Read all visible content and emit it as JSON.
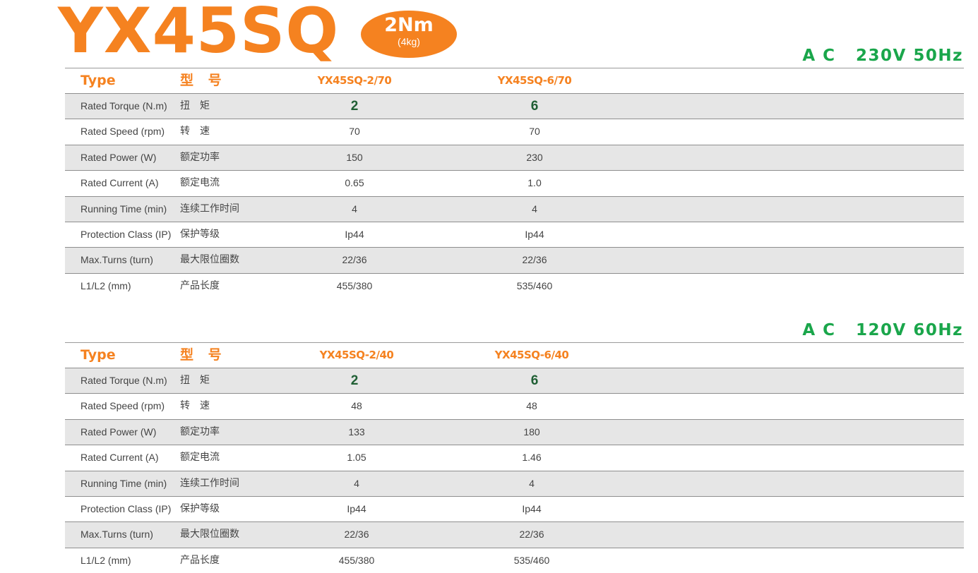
{
  "header": {
    "model": "YX45SQ",
    "torque_main": "2Nm",
    "torque_sub": "(4kg)"
  },
  "sections": [
    {
      "voltage": "A C   230V 50Hz",
      "type_en": "Type",
      "type_cn": "型 号",
      "models": [
        "YX45SQ-2/70",
        "YX45SQ-6/70"
      ],
      "rows": [
        {
          "en": "Rated Torque (N.m)",
          "cn": "扭　矩",
          "v": [
            "2",
            "6"
          ]
        },
        {
          "en": "Rated Speed (rpm)",
          "cn": "转　速",
          "v": [
            "70",
            "70"
          ]
        },
        {
          "en": "Rated Power (W)",
          "cn": "额定功率",
          "v": [
            "150",
            "230"
          ]
        },
        {
          "en": "Rated Current (A)",
          "cn": "额定电流",
          "v": [
            "0.65",
            "1.0"
          ]
        },
        {
          "en": "Running Time (min)",
          "cn": "连续工作时间",
          "v": [
            "4",
            "4"
          ]
        },
        {
          "en": "Protection Class (IP)",
          "cn": "保护等级",
          "v": [
            "Ip44",
            "Ip44"
          ]
        },
        {
          "en": "Max.Turns (turn)",
          "cn": "最大限位圈数",
          "v": [
            "22/36",
            "22/36"
          ]
        },
        {
          "en": "L1/L2 (mm)",
          "cn": "产品长度",
          "v": [
            "455/380",
            "535/460"
          ]
        }
      ]
    },
    {
      "voltage": "A C   120V 60Hz",
      "type_en": "Type",
      "type_cn": "型 号",
      "models": [
        "YX45SQ-2/40",
        "YX45SQ-6/40"
      ],
      "rows": [
        {
          "en": "Rated Torque (N.m)",
          "cn": "扭　矩",
          "v": [
            "2",
            "6"
          ]
        },
        {
          "en": "Rated Speed (rpm)",
          "cn": "转　速",
          "v": [
            "48",
            "48"
          ]
        },
        {
          "en": "Rated Power (W)",
          "cn": "额定功率",
          "v": [
            "133",
            "180"
          ]
        },
        {
          "en": "Rated Current (A)",
          "cn": "额定电流",
          "v": [
            "1.05",
            "1.46"
          ]
        },
        {
          "en": "Running Time (min)",
          "cn": "连续工作时间",
          "v": [
            "4",
            "4"
          ]
        },
        {
          "en": "Protection Class (IP)",
          "cn": "保护等级",
          "v": [
            "Ip44",
            "Ip44"
          ]
        },
        {
          "en": "Max.Turns (turn)",
          "cn": "最大限位圈数",
          "v": [
            "22/36",
            "22/36"
          ]
        },
        {
          "en": "L1/L2 (mm)",
          "cn": "产品长度",
          "v": [
            "455/380",
            "535/460"
          ]
        }
      ]
    }
  ]
}
